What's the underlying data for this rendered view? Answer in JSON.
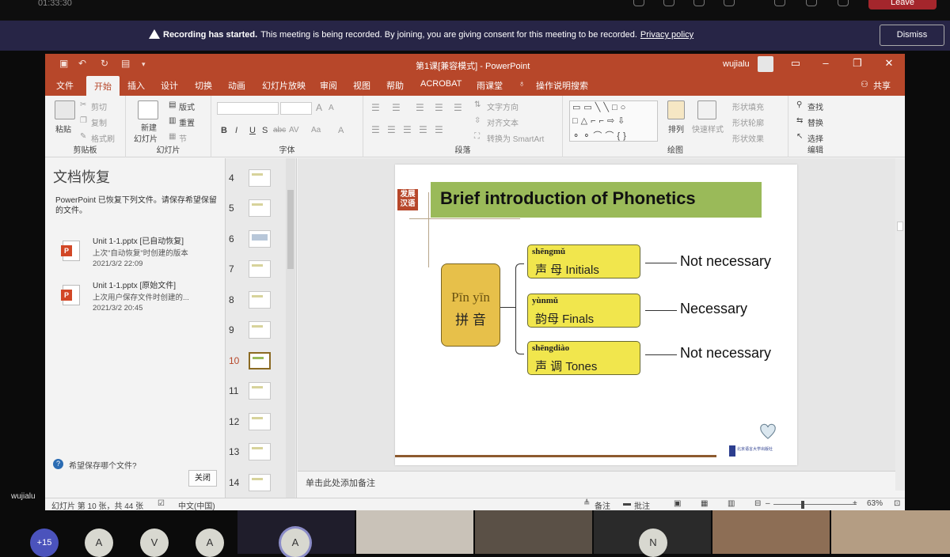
{
  "meeting": {
    "timer": "01:33:30",
    "leave_label": "Leave",
    "banner": {
      "bold": "Recording has started.",
      "text": "This meeting is being recorded. By joining, you are giving consent for this meeting to be recorded.",
      "link": "Privacy policy",
      "dismiss": "Dismiss"
    },
    "left_name": "wujialu",
    "participants": [
      {
        "label": "+15"
      },
      {
        "label": "A"
      },
      {
        "label": "V"
      },
      {
        "label": "A"
      },
      {
        "label": "A"
      },
      {
        "label": "N"
      }
    ]
  },
  "ppt": {
    "title": "第1课[兼容模式] - PowerPoint",
    "user": "wujialu",
    "tabs": [
      "文件",
      "开始",
      "插入",
      "设计",
      "切换",
      "动画",
      "幻灯片放映",
      "审阅",
      "视图",
      "帮助",
      "ACROBAT",
      "雨课堂",
      "操作说明搜索"
    ],
    "active_tab": "开始",
    "share": "共享",
    "ribbon": {
      "clipboard": {
        "paste": "粘贴",
        "cut": "剪切",
        "copy": "复制",
        "format_painter": "格式刷",
        "label": "剪贴板"
      },
      "slides": {
        "new": "新建",
        "new2": "幻灯片",
        "layout": "版式",
        "reset": "重置",
        "section": "节",
        "label": "幻灯片"
      },
      "font": {
        "label": "字体",
        "size_up": "A",
        "size_down": "A",
        "bold": "B",
        "italic": "I",
        "underline": "U",
        "shadow": "S",
        "strike": "abc",
        "spacing": "AV",
        "case": "Aa",
        "color": "A"
      },
      "paragraph": {
        "text_dir": "文字方向",
        "align": "对齐文本",
        "smartart": "转换为 SmartArt",
        "label": "段落"
      },
      "drawing": {
        "arrange": "排列",
        "quick_styles": "快速样式",
        "fill": "形状填充",
        "outline": "形状轮廓",
        "effects": "形状效果",
        "label": "绘图"
      },
      "editing": {
        "find": "查找",
        "replace": "替换",
        "select": "选择",
        "label": "编辑"
      }
    },
    "recovery": {
      "title": "文档恢复",
      "desc": "PowerPoint 已恢复下列文件。请保存希望保留的文件。",
      "files": [
        {
          "name": "Unit 1-1.pptx  [已自动恢复]",
          "sub": "上次\"自动恢复\"时创建的版本",
          "time": "2021/3/2 22:09"
        },
        {
          "name": "Unit 1-1.pptx  [原始文件]",
          "sub": "上次用户保存文件时创建的...",
          "time": "2021/3/2 20:45"
        }
      ],
      "help": "希望保存哪个文件?",
      "close": "关闭"
    },
    "thumbs": [
      "4",
      "5",
      "6",
      "7",
      "8",
      "9",
      "10",
      "11",
      "12",
      "13",
      "14"
    ],
    "selected_thumb": "10",
    "notes_placeholder": "单击此处添加备注",
    "status": {
      "slide": "幻灯片 第 10 张，共 44 张",
      "lang": "中文(中国)",
      "notes": "备注",
      "comments": "批注",
      "zoom": "63%",
      "zoom_value": 63
    }
  },
  "slide": {
    "logo_line1": "发展",
    "logo_line2": "汉语",
    "title": "Brief introduction of Phonetics",
    "pinyin_py": "Pīn yīn",
    "pinyin_zh": "拼 音",
    "items": [
      {
        "py": "shēngmǔ",
        "zh": "声  母  Initials",
        "note": "Not necessary"
      },
      {
        "py": "yùnmǔ",
        "zh": "韵母  Finals",
        "note": "Necessary"
      },
      {
        "py": "shēngdiào",
        "zh": "声    调   Tones",
        "note": "Not necessary"
      }
    ],
    "publisher": "北京语言大学出版社"
  },
  "colors": {
    "ppt_accent": "#b7472a",
    "banner_bg": "#272546",
    "title_bar": "#9aba59",
    "pinyin_box": "#e7c04a",
    "item_box": "#f1e64d"
  }
}
